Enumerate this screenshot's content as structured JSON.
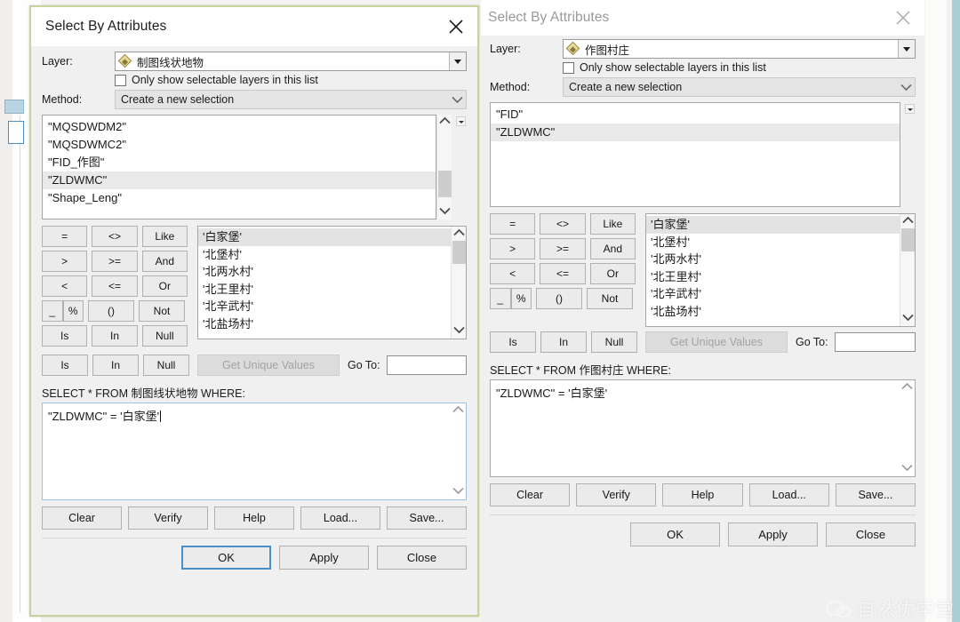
{
  "dialogs": [
    {
      "title": "Select By Attributes",
      "active": true,
      "labels": {
        "layer": "Layer:",
        "method": "Method:",
        "goto": "Go To:"
      },
      "layer": {
        "value": "制图线状地物",
        "icon": "polygon-layer-icon"
      },
      "only_selectable": "Only show selectable layers in this list",
      "method": {
        "value": "Create a new selection"
      },
      "fields": [
        "\"MQSDWDM2\"",
        "\"MQSDWMC2\"",
        "\"FID_作图\"",
        "\"ZLDWMC\"",
        "\"Shape_Leng\""
      ],
      "selected_field": "\"ZLDWMC\"",
      "operators": [
        [
          "=",
          "<>",
          "Like"
        ],
        [
          ">",
          ">=",
          "And"
        ],
        [
          "<",
          "<=",
          "Or"
        ],
        [
          "_",
          "%",
          "()",
          "Not"
        ],
        [
          "Is",
          "In",
          "Null"
        ]
      ],
      "unique_values": [
        "'白家堡'",
        "'北堡村'",
        "'北两水村'",
        "'北王里村'",
        "'北辛武村'",
        "'北盐场村'"
      ],
      "selected_value": "'白家堡'",
      "get_unique_values": "Get Unique Values",
      "goto_value": "",
      "sql_label": "SELECT * FROM 制图线状地物 WHERE:",
      "sql_text": "\"ZLDWMC\" = '白家堡'",
      "sql_has_cursor": true,
      "action_buttons": [
        "Clear",
        "Verify",
        "Help",
        "Load...",
        "Save..."
      ],
      "footer_buttons": [
        "OK",
        "Apply",
        "Close"
      ],
      "focused_footer_button": "OK"
    },
    {
      "title": "Select By Attributes",
      "active": false,
      "labels": {
        "layer": "Layer:",
        "method": "Method:",
        "goto": "Go To:"
      },
      "layer": {
        "value": "作图村庄",
        "icon": "polygon-layer-icon"
      },
      "only_selectable": "Only show selectable layers in this list",
      "method": {
        "value": "Create a new selection"
      },
      "fields": [
        "\"FID\"",
        "\"ZLDWMC\""
      ],
      "selected_field": "\"ZLDWMC\"",
      "operators": [
        [
          "=",
          "<>",
          "Like"
        ],
        [
          ">",
          ">=",
          "And"
        ],
        [
          "<",
          "<=",
          "Or"
        ],
        [
          "_",
          "%",
          "()",
          "Not"
        ],
        [
          "Is",
          "In",
          "Null"
        ]
      ],
      "unique_values": [
        "'白家堡'",
        "'北堡村'",
        "'北两水村'",
        "'北王里村'",
        "'北辛武村'",
        "'北盐场村'"
      ],
      "selected_value": "'白家堡'",
      "get_unique_values": "Get Unique Values",
      "goto_value": "",
      "sql_label": "SELECT * FROM 作图村庄 WHERE:",
      "sql_text": "\"ZLDWMC\" = '白家堡'",
      "sql_has_cursor": false,
      "action_buttons": [
        "Clear",
        "Verify",
        "Help",
        "Load...",
        "Save..."
      ],
      "footer_buttons": [
        "OK",
        "Apply",
        "Close"
      ],
      "focused_footer_button": ""
    }
  ],
  "watermark": {
    "text": "自然优学堂",
    "logo": "wechat-icon"
  },
  "colors": {
    "dialog_border_accent": "#c4d49a",
    "focus_blue": "#4a90c8",
    "selection_gray": "#e3e3e3",
    "teal_strip": "#a9d0d2"
  }
}
